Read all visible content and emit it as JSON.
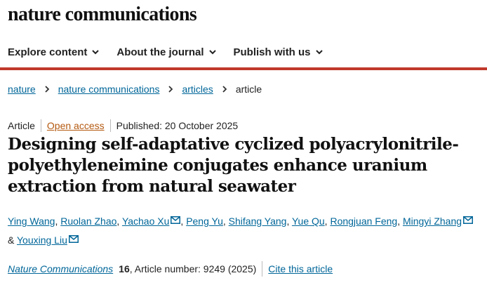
{
  "brand": "nature communications",
  "nav": {
    "items": [
      {
        "label": "Explore content"
      },
      {
        "label": "About the journal"
      },
      {
        "label": "Publish with us"
      }
    ]
  },
  "breadcrumb": {
    "items": [
      "nature",
      "nature communications",
      "articles"
    ],
    "current": "article"
  },
  "article": {
    "type": "Article",
    "access": "Open access",
    "published": "Published: 20 October 2025",
    "title": "Designing self-adaptative cyclized polyacrylonitrile-polyethyleneimine conjugates enhance uranium extraction from natural seawater",
    "authors": [
      "Ying Wang",
      "Ruolan Zhao",
      "Yachao Xu",
      "Peng Yu",
      "Shifang Yang",
      "Yue Qu",
      "Rongjuan Feng",
      "Mingyi Zhang",
      "Youxing Liu"
    ],
    "and_symbol": "&",
    "journal": "Nature Communications",
    "volume": "16",
    "article_number": ", Article number: 9249 (2025)",
    "cite_label": "Cite this article"
  },
  "colors": {
    "accent_bar": "#c0392b",
    "link": "#006699",
    "open_access": "#b4590f"
  },
  "icons": [
    "chevron-down-icon",
    "chevron-right-icon",
    "mail-icon"
  ]
}
